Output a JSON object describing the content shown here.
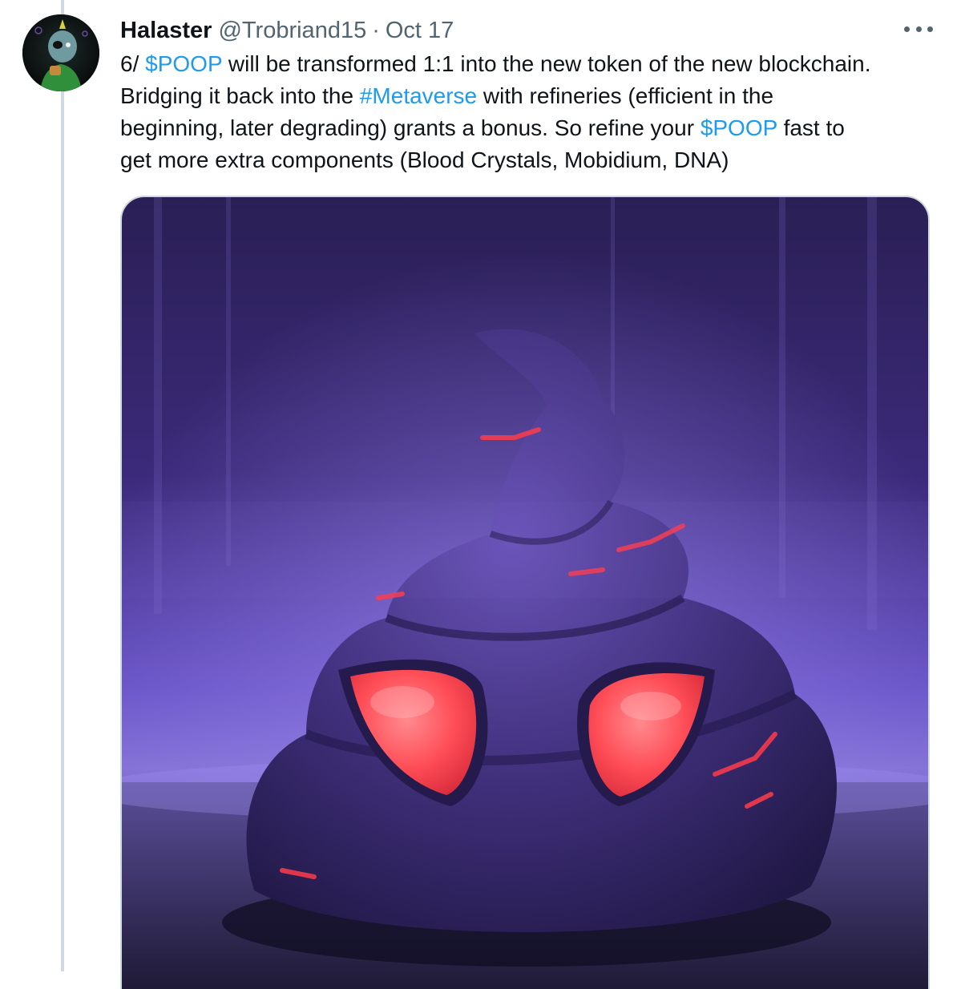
{
  "tweet": {
    "author": {
      "display_name": "Halaster",
      "handle": "@Trobriand15"
    },
    "separator": "·",
    "date": "Oct 17",
    "more_icon": "more-horizontal-icon",
    "text": {
      "l1_a": "6/ ",
      "l1_link": "$POOP",
      "l1_b": " will be transformed 1:1 into the new token of the new blockchain.",
      "l2_a": "Bridging it back into the ",
      "l2_link": "#Metaverse",
      "l2_b": " with refineries (efficient in the",
      "l3_a": "beginning, later degrading) grants a bonus. So refine your ",
      "l3_link": "$POOP",
      "l3_b": " fast to",
      "l4": "get more extra components (Blood Crystals, Mobidium, DNA)"
    },
    "media": {
      "image_subject": "purple-poop-creature-with-red-glowing-eyes"
    }
  },
  "colors": {
    "link": "#1d9bf0",
    "secondary_text": "#536471",
    "thread_line": "#cfd9de",
    "primary_text": "#0f1419"
  }
}
